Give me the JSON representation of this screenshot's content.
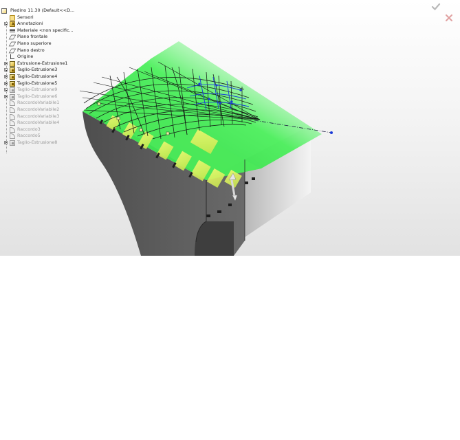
{
  "feature_tree": {
    "root": {
      "label": "Piedino 11.30  (Default<<D...",
      "icon": "part-icon"
    },
    "items": [
      {
        "label": "Sensori",
        "icon": "sensor-icon",
        "expandable": false,
        "suppressed": false
      },
      {
        "label": "Annotazioni",
        "icon": "annotations-icon",
        "expandable": true,
        "suppressed": false
      },
      {
        "label": "Materiale <non specific...",
        "icon": "material-icon",
        "expandable": false,
        "suppressed": false
      },
      {
        "label": "Piano frontale",
        "icon": "plane-icon",
        "expandable": false,
        "suppressed": false
      },
      {
        "label": "Piano superiore",
        "icon": "plane-icon",
        "expandable": false,
        "suppressed": false
      },
      {
        "label": "Piano destro",
        "icon": "plane-icon",
        "expandable": false,
        "suppressed": false
      },
      {
        "label": "Origine",
        "icon": "origin-icon",
        "expandable": false,
        "suppressed": false
      },
      {
        "label": "Estrusione-Estrusione1",
        "icon": "extrude-icon",
        "expandable": true,
        "suppressed": false
      },
      {
        "label": "Taglio-Estrusione3",
        "icon": "cut-extrude-icon",
        "expandable": true,
        "suppressed": false
      },
      {
        "label": "Taglio-Estrusione4",
        "icon": "cut-extrude-icon",
        "expandable": true,
        "suppressed": false
      },
      {
        "label": "Taglio-Estrusione5",
        "icon": "cut-extrude-icon",
        "expandable": true,
        "suppressed": false
      },
      {
        "label": "Taglio-Estrusione9",
        "icon": "cut-extrude-icon",
        "expandable": true,
        "suppressed": true
      },
      {
        "label": "Taglio-Estrusione6",
        "icon": "cut-extrude-icon",
        "expandable": true,
        "suppressed": true
      },
      {
        "label": "RaccordoVariabile1",
        "icon": "fillet-icon",
        "expandable": false,
        "suppressed": true
      },
      {
        "label": "RaccordoVariabile2",
        "icon": "fillet-icon",
        "expandable": false,
        "suppressed": true
      },
      {
        "label": "RaccordoVariabile3",
        "icon": "fillet-icon",
        "expandable": false,
        "suppressed": true
      },
      {
        "label": "RaccordoVariabile4",
        "icon": "fillet-icon",
        "expandable": false,
        "suppressed": true
      },
      {
        "label": "Raccordo3",
        "icon": "fillet-icon",
        "expandable": false,
        "suppressed": true
      },
      {
        "label": "Raccordo5",
        "icon": "fillet-icon",
        "expandable": false,
        "suppressed": true
      },
      {
        "label": "Taglio-Estrusione8",
        "icon": "cut-extrude-icon",
        "expandable": true,
        "suppressed": true
      }
    ]
  },
  "confirm_corner": {
    "ok_icon": "checkmark-icon",
    "cancel_icon": "close-icon"
  },
  "colors": {
    "ok": "#b9b9b9",
    "cancel": "#e0a0a0",
    "model_face": "#5c5c5c",
    "preview_green": "#38e84a",
    "preview_yellow": "#e8f060",
    "handle_blue": "#1a3ad8"
  }
}
